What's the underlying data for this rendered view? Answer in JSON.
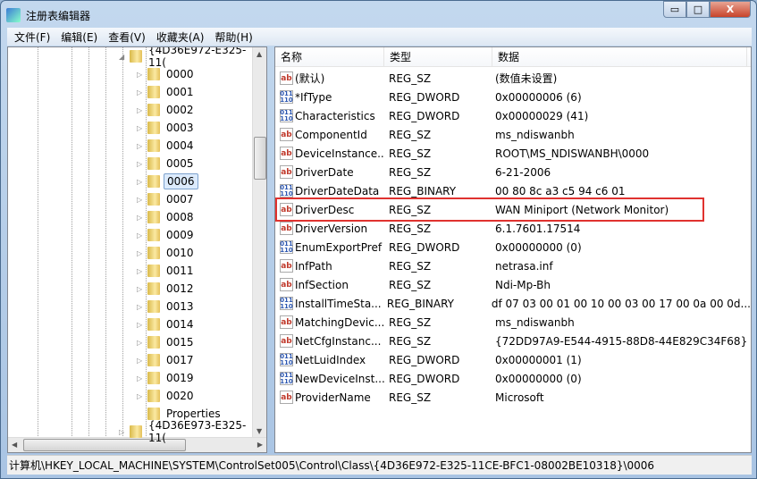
{
  "window": {
    "title": "注册表编辑器",
    "minimize": "▭",
    "maximize": "□",
    "close": "X"
  },
  "menu": [
    "文件(F)",
    "编辑(E)",
    "查看(V)",
    "收藏夹(A)",
    "帮助(H)"
  ],
  "tree": {
    "parent": "{4D36E972-E325-11CE-BFC1-08002BE10318}",
    "parent_display": "{4D36E972-E325-11(",
    "children": [
      "0000",
      "0001",
      "0002",
      "0003",
      "0004",
      "0005",
      "0006",
      "0007",
      "0008",
      "0009",
      "0010",
      "0011",
      "0012",
      "0013",
      "0014",
      "0015",
      "0017",
      "0019",
      "0020",
      "Properties"
    ],
    "selected": "0006",
    "next": "{4D36E973-E325-11("
  },
  "list": {
    "headers": [
      "名称",
      "类型",
      "数据"
    ],
    "rows": [
      {
        "name": "(默认)",
        "type": "REG_SZ",
        "data": "(数值未设置)",
        "icon": "string"
      },
      {
        "name": "*IfType",
        "type": "REG_DWORD",
        "data": "0x00000006 (6)",
        "icon": "binary"
      },
      {
        "name": "Characteristics",
        "type": "REG_DWORD",
        "data": "0x00000029 (41)",
        "icon": "binary"
      },
      {
        "name": "ComponentId",
        "type": "REG_SZ",
        "data": "ms_ndiswanbh",
        "icon": "string"
      },
      {
        "name": "DeviceInstance...",
        "type": "REG_SZ",
        "data": "ROOT\\MS_NDISWANBH\\0000",
        "icon": "string"
      },
      {
        "name": "DriverDate",
        "type": "REG_SZ",
        "data": "6-21-2006",
        "icon": "string"
      },
      {
        "name": "DriverDateData",
        "type": "REG_BINARY",
        "data": "00 80 8c a3 c5 94 c6 01",
        "icon": "binary"
      },
      {
        "name": "DriverDesc",
        "type": "REG_SZ",
        "data": "WAN Miniport (Network Monitor)",
        "icon": "string",
        "highlighted": true
      },
      {
        "name": "DriverVersion",
        "type": "REG_SZ",
        "data": "6.1.7601.17514",
        "icon": "string"
      },
      {
        "name": "EnumExportPref",
        "type": "REG_DWORD",
        "data": "0x00000000 (0)",
        "icon": "binary"
      },
      {
        "name": "InfPath",
        "type": "REG_SZ",
        "data": "netrasa.inf",
        "icon": "string"
      },
      {
        "name": "InfSection",
        "type": "REG_SZ",
        "data": "Ndi-Mp-Bh",
        "icon": "string"
      },
      {
        "name": "InstallTimeSta...",
        "type": "REG_BINARY",
        "data": "df 07 03 00 01 00 10 00 03 00 17 00 0a 00 0d...",
        "icon": "binary"
      },
      {
        "name": "MatchingDevic...",
        "type": "REG_SZ",
        "data": "ms_ndiswanbh",
        "icon": "string"
      },
      {
        "name": "NetCfgInstanc...",
        "type": "REG_SZ",
        "data": "{72DD97A9-E544-4915-88D8-44E829C34F68}",
        "icon": "string"
      },
      {
        "name": "NetLuidIndex",
        "type": "REG_DWORD",
        "data": "0x00000001 (1)",
        "icon": "binary"
      },
      {
        "name": "NewDeviceInst...",
        "type": "REG_DWORD",
        "data": "0x00000000 (0)",
        "icon": "binary"
      },
      {
        "name": "ProviderName",
        "type": "REG_SZ",
        "data": "Microsoft",
        "icon": "string"
      }
    ]
  },
  "highlight_color": "#e0322f",
  "status": "计算机\\HKEY_LOCAL_MACHINE\\SYSTEM\\ControlSet005\\Control\\Class\\{4D36E972-E325-11CE-BFC1-08002BE10318}\\0006"
}
